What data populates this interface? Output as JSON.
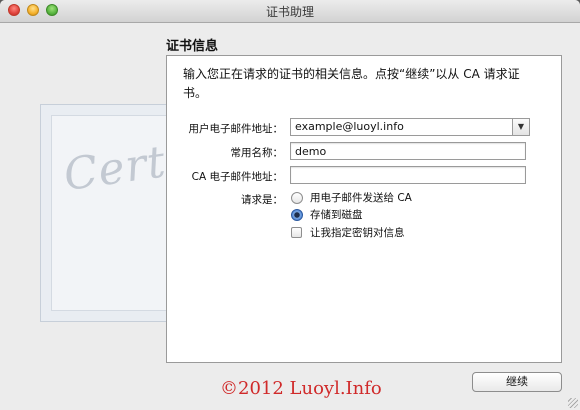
{
  "window": {
    "title": "证书助理"
  },
  "section": {
    "title": "证书信息"
  },
  "panel": {
    "description": "输入您正在请求的证书的相关信息。点按“继续”以从 CA 请求证书。"
  },
  "form": {
    "email_label": "用户电子邮件地址：",
    "email_value": "example@luoyl.info",
    "common_name_label": "常用名称：",
    "common_name_value": "demo",
    "ca_email_label": "CA 电子邮件地址：",
    "ca_email_value": "",
    "request_label": "请求是：",
    "options": {
      "email_to_ca": "用电子邮件发送给 CA",
      "save_to_disk": "存储到磁盘",
      "specify_key_pair": "让我指定密钥对信息"
    },
    "selected_option": "save_to_disk"
  },
  "artwork": {
    "certificate_word": "Certificate"
  },
  "footer": {
    "watermark": "©2012 Luoyl.Info",
    "continue_label": "继续"
  },
  "colors": {
    "watermark": "#d02a2a",
    "radio_selected": "#2f6bd0"
  }
}
